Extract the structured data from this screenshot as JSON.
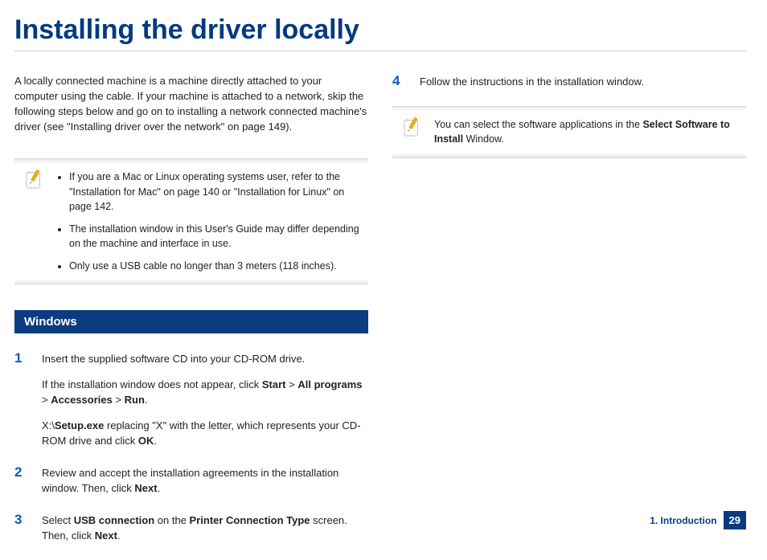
{
  "title": "Installing the driver locally",
  "intro": "A locally connected machine is a machine directly attached to your computer using the cable. If your machine is attached to a network, skip the following steps below and go on to installing a network connected machine's driver (see \"Installing driver over the network\" on page 149).",
  "note1": {
    "items": [
      "If you are a Mac or Linux operating systems user, refer to the \"Installation for Mac\" on page 140 or \"Installation for Linux\" on page 142.",
      "The installation window in this User's Guide may differ depending on the machine and interface in use.",
      "Only use a USB cable no longer than 3 meters (118 inches)."
    ]
  },
  "section": "Windows",
  "steps": {
    "s1": {
      "num": "1",
      "p1": "Insert the supplied software CD into your CD-ROM drive.",
      "p2_pre": "If the installation window does not appear, click ",
      "start": "Start",
      "gt1": " > ",
      "allprog": "All programs",
      "gt2": " > ",
      "acc": "Accessories",
      "gt3": " > ",
      "run": "Run",
      "p2_post": ".",
      "p3_pre": " X:\\",
      "setup": "Setup.exe",
      "p3_mid": " replacing \"X\" with the letter, which represents your CD-ROM drive and click ",
      "ok": "OK",
      "p3_post": "."
    },
    "s2": {
      "num": "2",
      "pre": "Review and accept the installation agreements in the installation window. Then, click ",
      "next": "Next",
      "post": "."
    },
    "s3": {
      "num": "3",
      "pre": "Select ",
      "usb": "USB connection",
      "mid": " on the ",
      "pct": "Printer Connection Type",
      "mid2": " screen. Then, click ",
      "next": "Next",
      "post": "."
    },
    "s4": {
      "num": "4",
      "text": "Follow the instructions in the installation window."
    }
  },
  "note2": {
    "pre": "You can select the software applications in the ",
    "bold": "Select Software to Install",
    "post": " Window."
  },
  "footer": {
    "chapter": "1. Introduction",
    "page": "29"
  }
}
